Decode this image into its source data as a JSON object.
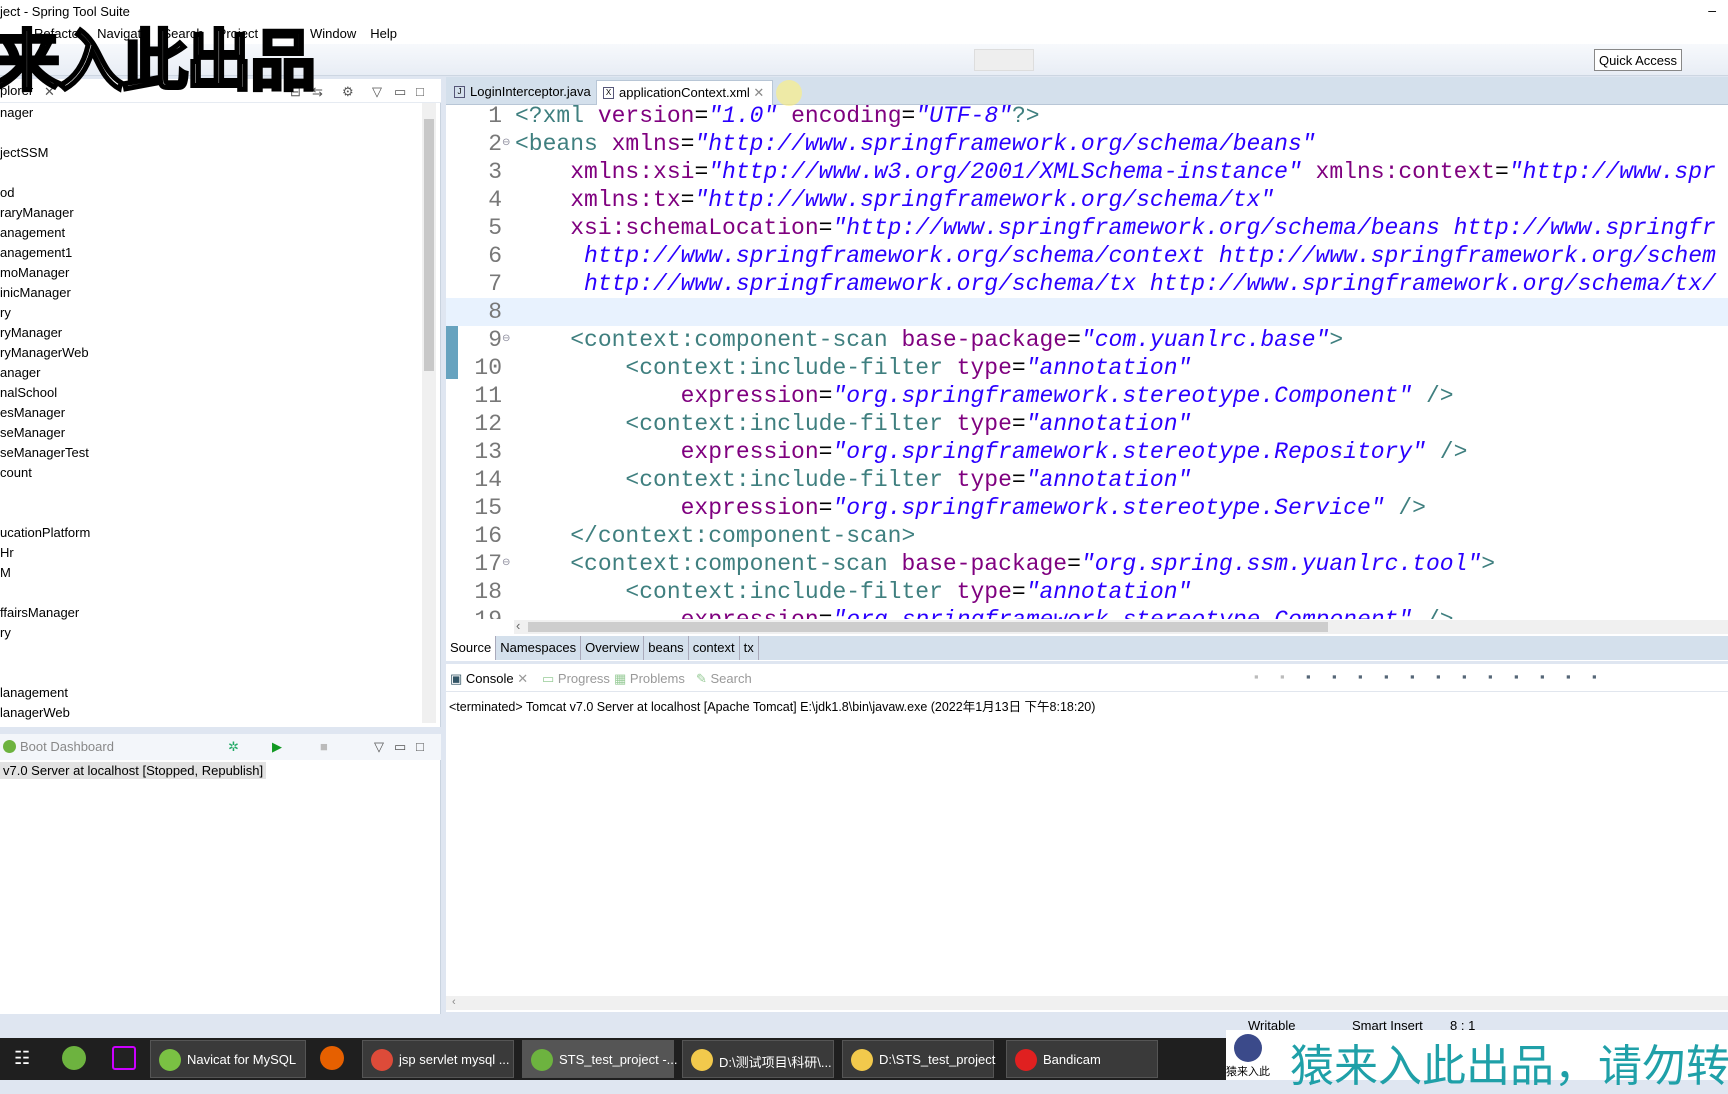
{
  "window": {
    "title": "ject - Spring Tool Suite"
  },
  "menu": [
    "Refactor",
    "Navigate",
    "Search",
    "Project",
    "Run",
    "Window",
    "Help"
  ],
  "toolbar": {
    "quick_access": "Quick Access"
  },
  "explorer": {
    "title": "plorer",
    "items": [
      "nager",
      "",
      "jectSSM",
      "",
      "od",
      "raryManager",
      "anagement",
      "anagement1",
      "moManager",
      "inicManager",
      "ry",
      "ryManager",
      "ryManagerWeb",
      "anager",
      "nalSchool",
      "esManager",
      "seManager",
      "seManagerTest",
      "count",
      "",
      "",
      "ucationPlatform",
      "Hr",
      "M",
      "",
      "ffairsManager",
      "ry",
      "",
      "",
      "lanagement",
      "lanagerWeb"
    ]
  },
  "boot": {
    "title": "Boot Dashboard",
    "server": "v7.0 Server at localhost  [Stopped, Republish]"
  },
  "editor": {
    "tabs": [
      {
        "label": "LoginInterceptor.java",
        "icon": "java-file-icon",
        "active": false
      },
      {
        "label": "applicationContext.xml",
        "icon": "xml-file-icon",
        "active": true
      }
    ],
    "current_line": 8,
    "lines": [
      {
        "n": "1",
        "t": [
          [
            "b",
            "<?xml "
          ],
          [
            "a",
            "version"
          ],
          [
            "e",
            "="
          ],
          [
            "s",
            "\"1.0\""
          ],
          [
            "a",
            " encoding"
          ],
          [
            "e",
            "="
          ],
          [
            "s",
            "\"UTF-8\""
          ],
          [
            "b",
            "?>"
          ]
        ]
      },
      {
        "n": "2",
        "f": true,
        "t": [
          [
            "b",
            "<beans "
          ],
          [
            "a",
            "xmlns"
          ],
          [
            "e",
            "="
          ],
          [
            "s",
            "\"http://www.springframework.org/schema/beans\""
          ]
        ]
      },
      {
        "n": "3",
        "t": [
          [
            "a",
            "    xmlns:xsi"
          ],
          [
            "e",
            "="
          ],
          [
            "s",
            "\"http://www.w3.org/2001/XMLSchema-instance\""
          ],
          [
            "a",
            " xmlns:context"
          ],
          [
            "e",
            "="
          ],
          [
            "s",
            "\"http://www.spr"
          ]
        ]
      },
      {
        "n": "4",
        "t": [
          [
            "a",
            "    xmlns:tx"
          ],
          [
            "e",
            "="
          ],
          [
            "s",
            "\"http://www.springframework.org/schema/tx\""
          ]
        ]
      },
      {
        "n": "5",
        "t": [
          [
            "a",
            "    xsi:schemaLocation"
          ],
          [
            "e",
            "="
          ],
          [
            "s",
            "\"http://www.springframework.org/schema/beans http://www.springfr"
          ]
        ]
      },
      {
        "n": "6",
        "t": [
          [
            "s",
            "     http://www.springframework.org/schema/context http://www.springframework.org/schem"
          ]
        ]
      },
      {
        "n": "7",
        "t": [
          [
            "s",
            "     http://www.springframework.org/schema/tx http://www.springframework.org/schema/tx/"
          ]
        ]
      },
      {
        "n": "8",
        "t": []
      },
      {
        "n": "9",
        "f": true,
        "t": [
          [
            "b",
            "    <context:component-scan "
          ],
          [
            "a",
            "base-package"
          ],
          [
            "e",
            "="
          ],
          [
            "s",
            "\"com.yuanlrc.base\""
          ],
          [
            "b",
            ">"
          ]
        ]
      },
      {
        "n": "10",
        "t": [
          [
            "b",
            "        <context:include-filter "
          ],
          [
            "a",
            "type"
          ],
          [
            "e",
            "="
          ],
          [
            "s",
            "\"annotation\""
          ]
        ]
      },
      {
        "n": "11",
        "t": [
          [
            "a",
            "            expression"
          ],
          [
            "e",
            "="
          ],
          [
            "s",
            "\"org.springframework.stereotype.Component\""
          ],
          [
            "b",
            " />"
          ]
        ]
      },
      {
        "n": "12",
        "t": [
          [
            "b",
            "        <context:include-filter "
          ],
          [
            "a",
            "type"
          ],
          [
            "e",
            "="
          ],
          [
            "s",
            "\"annotation\""
          ]
        ]
      },
      {
        "n": "13",
        "t": [
          [
            "a",
            "            expression"
          ],
          [
            "e",
            "="
          ],
          [
            "s",
            "\"org.springframework.stereotype.Repository\""
          ],
          [
            "b",
            " />"
          ]
        ]
      },
      {
        "n": "14",
        "t": [
          [
            "b",
            "        <context:include-filter "
          ],
          [
            "a",
            "type"
          ],
          [
            "e",
            "="
          ],
          [
            "s",
            "\"annotation\""
          ]
        ]
      },
      {
        "n": "15",
        "t": [
          [
            "a",
            "            expression"
          ],
          [
            "e",
            "="
          ],
          [
            "s",
            "\"org.springframework.stereotype.Service\""
          ],
          [
            "b",
            " />"
          ]
        ]
      },
      {
        "n": "16",
        "t": [
          [
            "b",
            "    </context:component-scan>"
          ]
        ]
      },
      {
        "n": "17",
        "f": true,
        "t": [
          [
            "b",
            "    <context:component-scan "
          ],
          [
            "a",
            "base-package"
          ],
          [
            "e",
            "="
          ],
          [
            "s",
            "\"org.spring.ssm.yuanlrc.tool\""
          ],
          [
            "b",
            ">"
          ]
        ]
      },
      {
        "n": "18",
        "t": [
          [
            "b",
            "        <context:include-filter "
          ],
          [
            "a",
            "type"
          ],
          [
            "e",
            "="
          ],
          [
            "s",
            "\"annotation\""
          ]
        ]
      },
      {
        "n": "19",
        "t": [
          [
            "a",
            "            expression"
          ],
          [
            "e",
            "="
          ],
          [
            "s",
            "\"org.springframework.stereotype.Component\""
          ],
          [
            "b",
            " />"
          ]
        ]
      }
    ],
    "source_tabs": [
      "Source",
      "Namespaces",
      "Overview",
      "beans",
      "context",
      "tx"
    ],
    "active_source_tab": "Source"
  },
  "console": {
    "tabs": [
      "Console",
      "Progress",
      "Problems",
      "Search"
    ],
    "text": "<terminated> Tomcat v7.0 Server at localhost [Apache Tomcat] E:\\jdk1.8\\bin\\javaw.exe (2022年1月13日 下午8:18:20)"
  },
  "status": {
    "writable": "Writable",
    "insert_mode": "Smart Insert",
    "position": "8 : 1"
  },
  "taskbar": [
    {
      "label": "Navicat for MySQL",
      "color": "#7ac143"
    },
    {
      "label": "jsp servlet mysql ...",
      "color": "#dd4b39"
    },
    {
      "label": "STS_test_project -...",
      "color": "#6db33f",
      "active": true
    },
    {
      "label": "D:\\测试项目\\科研\\...",
      "color": "#f2c94c"
    },
    {
      "label": "D:\\STS_test_project",
      "color": "#f2c94c"
    },
    {
      "label": "Bandicam",
      "color": "#e02020"
    }
  ],
  "watermark": {
    "top": "来入此出品",
    "bottom": "猿来入此出品，请勿转",
    "logo_text": "猿来入此"
  }
}
